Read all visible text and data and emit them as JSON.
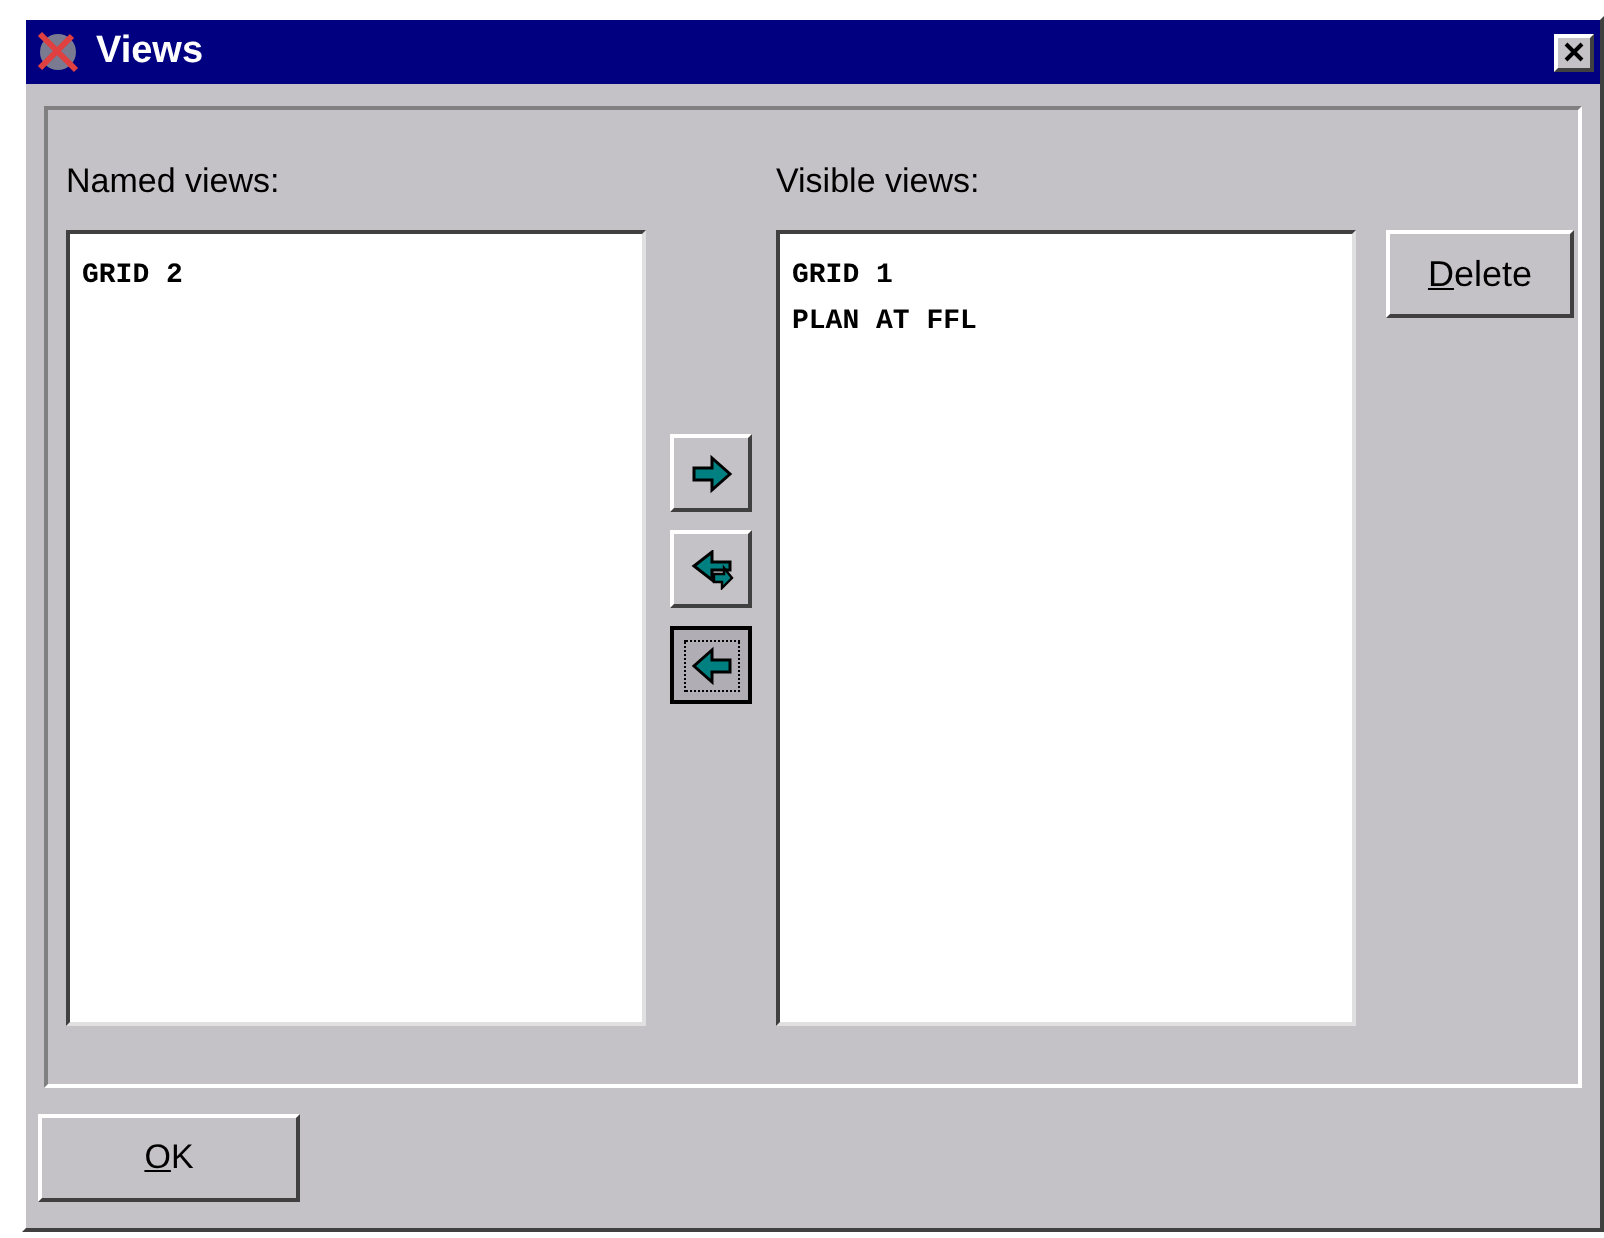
{
  "window": {
    "title": "Views"
  },
  "named_views": {
    "label": "Named views:",
    "items": [
      "GRID 2"
    ]
  },
  "transfer_buttons": [
    {
      "kind": "right",
      "focused": false
    },
    {
      "kind": "swap",
      "focused": false
    },
    {
      "kind": "left",
      "focused": true
    }
  ],
  "visible_views": {
    "label": "Visible views:",
    "items": [
      "GRID 1",
      "PLAN AT FFL"
    ]
  },
  "buttons": [
    {
      "label": "Delete"
    },
    {
      "label": "OK"
    }
  ]
}
